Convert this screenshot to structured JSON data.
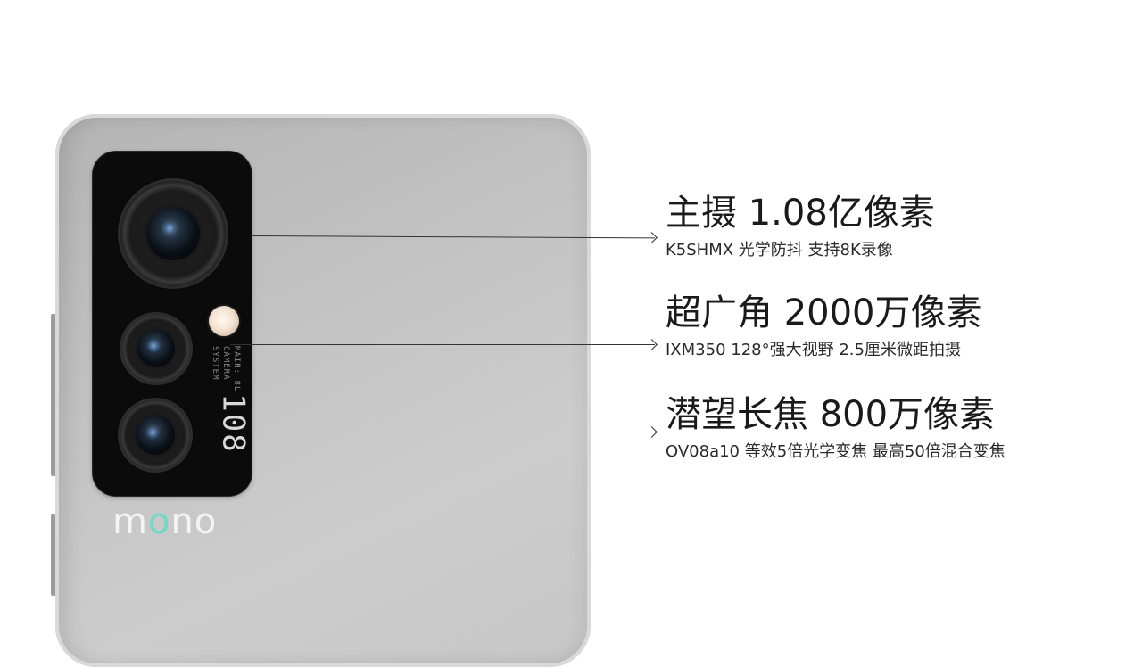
{
  "brand": {
    "name_prefix": "m",
    "name_dot": "o",
    "name_suffix": "no",
    "accent": "#6fd8c6"
  },
  "module": {
    "lens_badge": "108",
    "spec_lines": [
      "MAIN: 8L",
      "CAMERA",
      "SYSTEM"
    ]
  },
  "features": [
    {
      "title": "主摄 1.08亿像素",
      "subtitle": "K5SHMX 光学防抖 支持8K录像"
    },
    {
      "title": "超广角 2000万像素",
      "subtitle": "IXM350 128°强大视野 2.5厘米微距拍摄"
    },
    {
      "title": "潜望长焦 800万像素",
      "subtitle": "OV08a10 等效5倍光学变焦 最高50倍混合变焦"
    }
  ],
  "colors": {
    "phone_body": "#c3c3c3",
    "module": "#0b0b0b",
    "text": "#1a1a1a"
  }
}
